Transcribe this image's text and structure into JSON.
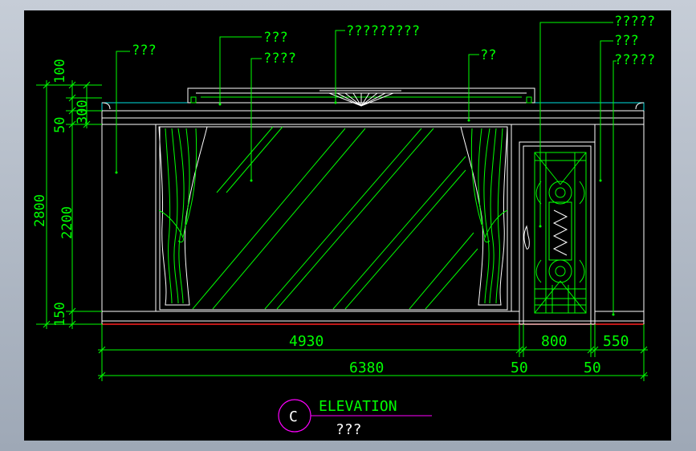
{
  "drawing": {
    "background": "#000000",
    "frame_color": "#a0aab8",
    "colors": {
      "green": "#00ff00",
      "white": "#ffffff",
      "cyan": "#00e0e0",
      "red": "#ff2020",
      "magenta": "#ff00ff",
      "yellow": "#e0e000"
    },
    "callouts": {
      "c1": "???",
      "c2": "???",
      "c3": "????",
      "c4": "?????????",
      "c5": "??",
      "c6": "?????",
      "c7": "???",
      "c8": "?????"
    },
    "left_dims": {
      "outer": "2800",
      "top_100": "100",
      "top_50": "50",
      "top_300": "300",
      "mid_2200": "2200",
      "bottom_150": "150"
    },
    "bottom_dims": {
      "w_4930": "4930",
      "w_800": "800",
      "w_550": "550",
      "total_6380": "6380",
      "gap_50a": "50",
      "gap_50b": "50"
    },
    "title": {
      "symbol": "C",
      "label": "ELEVATION",
      "sub": "???"
    }
  }
}
